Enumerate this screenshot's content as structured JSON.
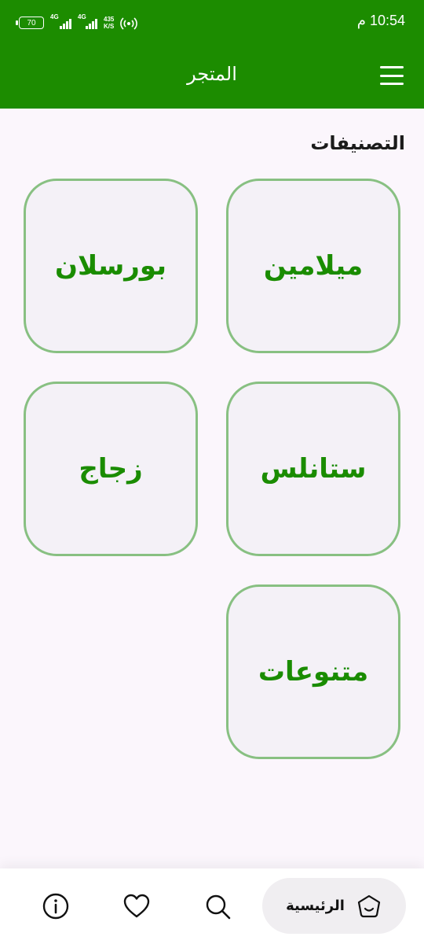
{
  "status_bar": {
    "time": "10:54 م",
    "battery": "70",
    "network1": "4G",
    "network2": "4G",
    "speed_value": "435",
    "speed_unit": "K/S"
  },
  "appbar": {
    "title": "المتجر",
    "menu_icon": "hamburger-menu-icon"
  },
  "categories": {
    "heading": "التصنيفات",
    "items": [
      {
        "label": "ميلامين"
      },
      {
        "label": "بورسلان"
      },
      {
        "label": "ستانلس"
      },
      {
        "label": "زجاج"
      },
      {
        "label": "متنوعات"
      }
    ]
  },
  "bottom_nav": {
    "home_label": "الرئيسية",
    "icons": [
      "home-icon",
      "search-icon",
      "heart-icon",
      "info-icon"
    ]
  },
  "colors": {
    "brand_green": "#1c8c00",
    "card_border": "#88c082",
    "card_bg": "#f4f1f7",
    "page_bg": "#fbf6fc"
  }
}
